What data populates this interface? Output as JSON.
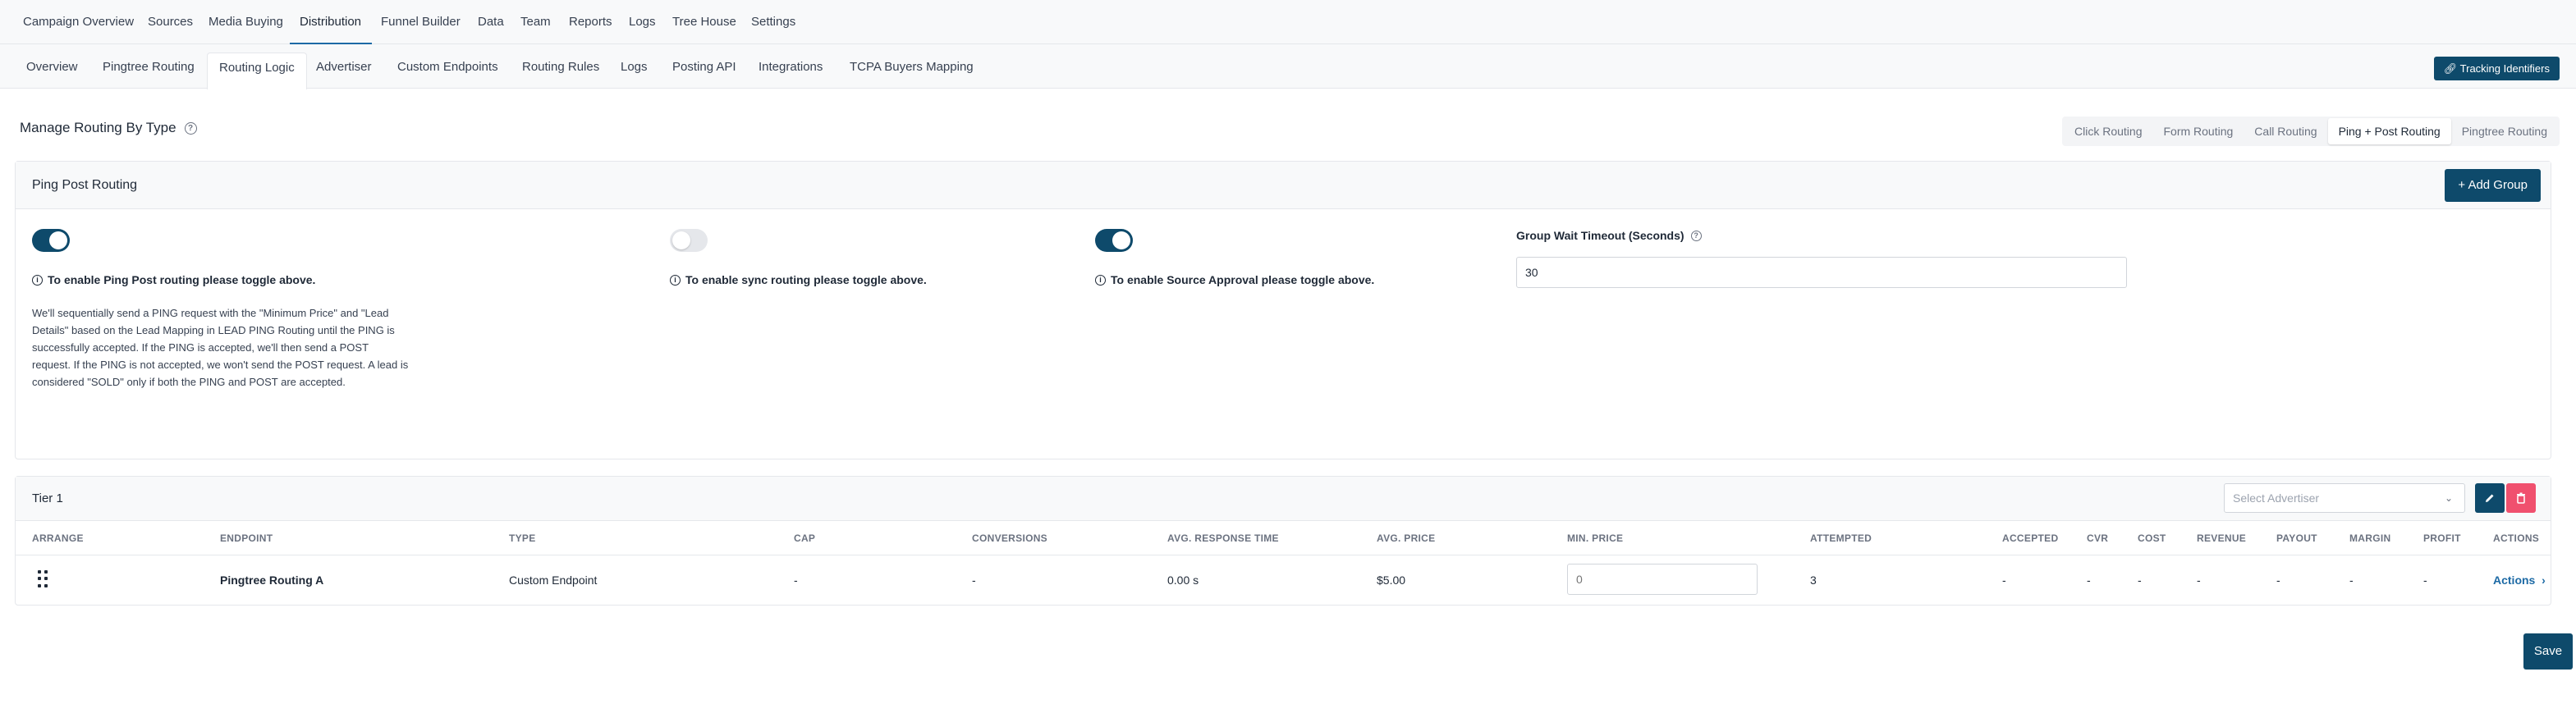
{
  "top_nav": {
    "items": [
      "Campaign Overview",
      "Sources",
      "Media Buying",
      "Distribution",
      "Funnel Builder",
      "Data",
      "Team",
      "Reports",
      "Logs",
      "Tree House",
      "Settings"
    ],
    "active": "Distribution"
  },
  "sub_nav": {
    "tabs": [
      "Overview",
      "Pingtree Routing",
      "Routing Logic",
      "Advertiser",
      "Custom Endpoints",
      "Routing Rules",
      "Logs",
      "Posting API",
      "Integrations",
      "TCPA Buyers Mapping"
    ],
    "active": "Routing Logic",
    "tracking_button": "Tracking Identifiers",
    "tracking_icon": "link-icon"
  },
  "page": {
    "title": "Manage Routing By Type",
    "routing_types": [
      "Click Routing",
      "Form Routing",
      "Call Routing",
      "Ping + Post Routing",
      "Pingtree Routing"
    ],
    "active_routing_type": "Ping + Post Routing"
  },
  "ping_post": {
    "title": "Ping Post Routing",
    "add_group_button": "+ Add Group",
    "toggles": {
      "ping_post": true,
      "sync": false,
      "source_approval": true
    },
    "ping_post_hint": "To enable Ping Post routing please toggle above.",
    "sync_hint": "To enable sync routing please toggle above.",
    "source_approval_hint": "To enable Source Approval please toggle above.",
    "description": "We'll sequentially send a PING request with the \"Minimum Price\" and \"Lead Details\" based on the Lead Mapping in LEAD PING Routing until the PING is successfully accepted. If the PING is accepted, we'll then send a POST request. If the PING is not accepted, we won't send the POST request. A lead is considered \"SOLD\" only if both the PING and POST are accepted.",
    "group_wait_timeout_label": "Group Wait Timeout (Seconds)",
    "group_wait_timeout_value": "30"
  },
  "tier": {
    "title": "Tier 1",
    "select_advertiser_placeholder": "Select Advertiser",
    "columns": [
      "ARRANGE",
      "ENDPOINT",
      "TYPE",
      "CAP",
      "CONVERSIONS",
      "AVG. RESPONSE TIME",
      "AVG. PRICE",
      "MIN. PRICE",
      "ATTEMPTED",
      "ACCEPTED",
      "CVR",
      "COST",
      "REVENUE",
      "PAYOUT",
      "MARGIN",
      "PROFIT",
      "ACTIONS"
    ],
    "rows": [
      {
        "endpoint": "Pingtree Routing A",
        "type": "Custom Endpoint",
        "cap": "-",
        "conversions": "-",
        "avg_response_time": "0.00 s",
        "avg_price": "$5.00",
        "min_price_placeholder": "0",
        "attempted": "3",
        "accepted": "-",
        "cvr": "-",
        "cost": "-",
        "revenue": "-",
        "payout": "-",
        "margin": "-",
        "profit": "-",
        "actions": "Actions"
      }
    ]
  },
  "save_button": "Save",
  "colors": {
    "primary": "#0e4a6b",
    "link": "#1d6aa5",
    "danger": "#f0506e"
  }
}
